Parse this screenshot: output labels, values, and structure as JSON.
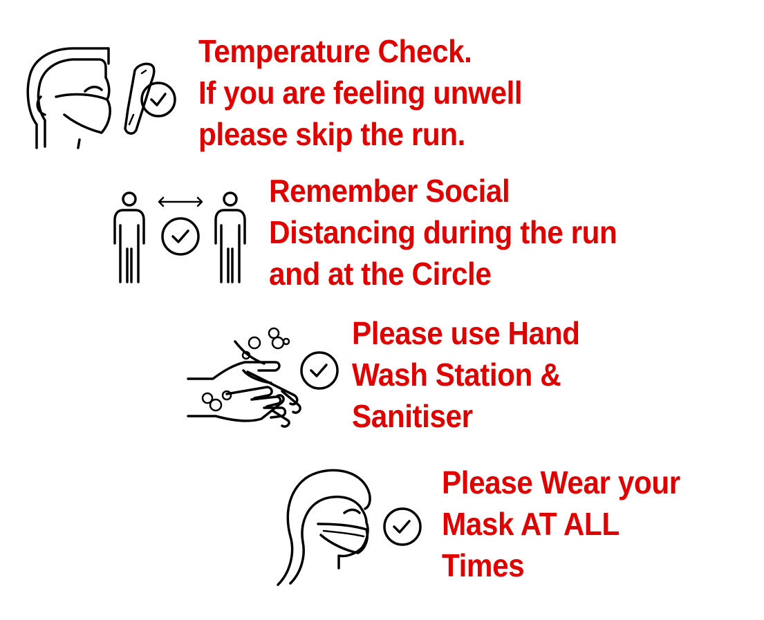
{
  "colors": {
    "text": "#e00000",
    "icon": "#000000",
    "background": "#ffffff"
  },
  "items": [
    {
      "icon": "temperature-check-icon",
      "lines": [
        "Temperature Check.",
        "If you are feeling unwell",
        "please skip the run."
      ]
    },
    {
      "icon": "social-distancing-icon",
      "lines": [
        "Remember Social",
        "Distancing during the run",
        "and at the Circle"
      ]
    },
    {
      "icon": "hand-wash-icon",
      "lines": [
        "Please use Hand",
        "Wash Station &",
        "Sanitiser"
      ]
    },
    {
      "icon": "wear-mask-icon",
      "lines": [
        "Please Wear your",
        "Mask AT ALL",
        "Times"
      ]
    }
  ]
}
